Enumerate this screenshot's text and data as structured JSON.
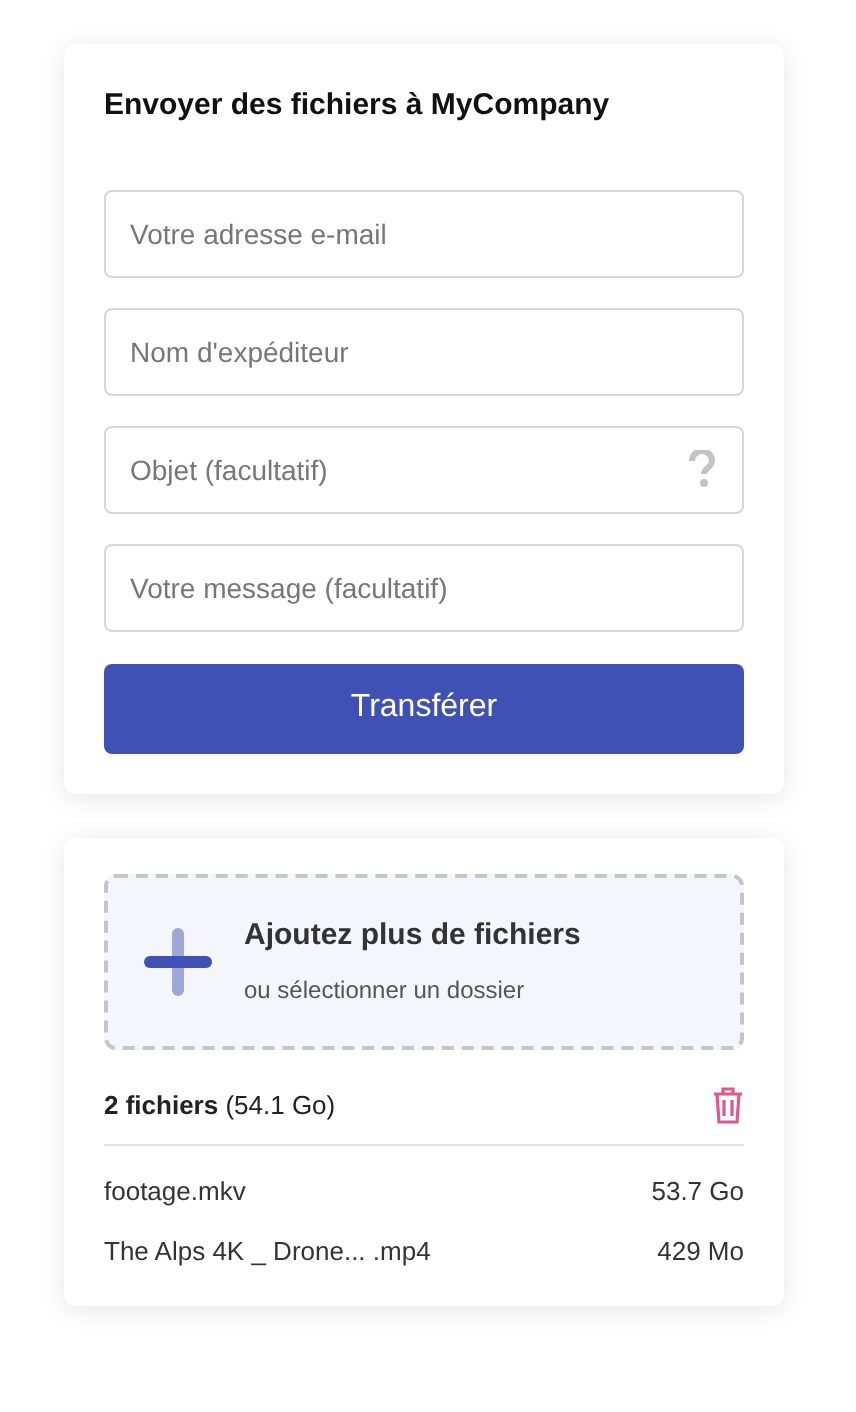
{
  "form": {
    "title": "Envoyer des fichiers à MyCompany",
    "fields": [
      {
        "kind": "text",
        "placeholder": "Votre adresse e-mail"
      },
      {
        "kind": "text",
        "placeholder": "Nom d'expéditeur"
      },
      {
        "kind": "help",
        "placeholder": "Objet (facultatif)"
      },
      {
        "kind": "text",
        "placeholder": "Votre message (facultatif)"
      }
    ],
    "submit": "Transférer"
  },
  "files": {
    "add_title": "Ajoutez plus de fichiers",
    "add_subtitle": "ou sélectionner un dossier",
    "summary": "**2 fichiers** (54.1 Go)",
    "items": [
      {
        "name": "footage.mkv",
        "size": "53.7 Go"
      },
      {
        "name": "The Alps 4K _ Drone... .mp4",
        "size": "429 Mo"
      }
    ]
  }
}
